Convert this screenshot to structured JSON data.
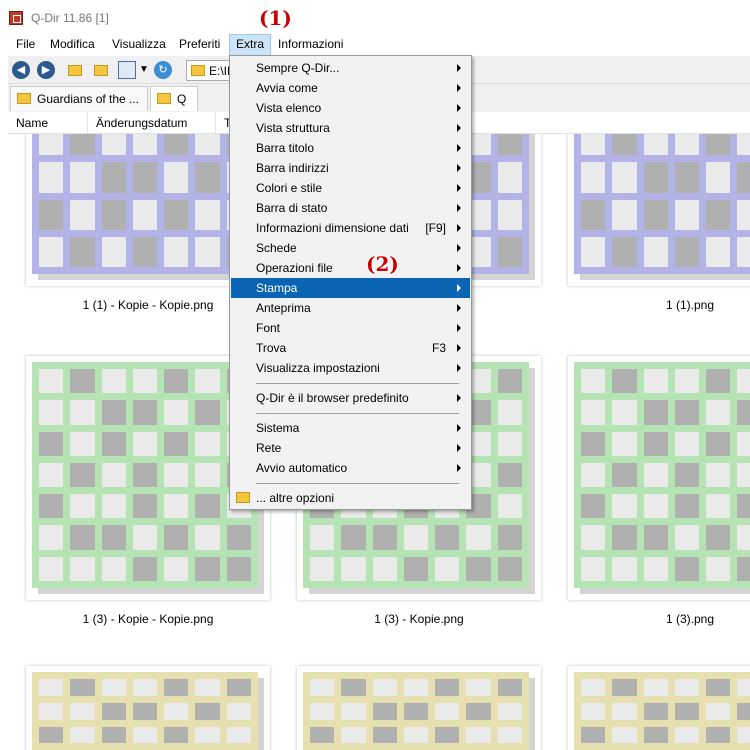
{
  "window": {
    "title": "Q-Dir 11.86 [1]"
  },
  "annotations": {
    "first": "(1)",
    "second": "(2)"
  },
  "menubar": [
    "File",
    "Modifica",
    "Visualizza",
    "Preferiti",
    "Extra",
    "Informazioni"
  ],
  "address": {
    "path": "E:\\INE"
  },
  "tabs": [
    {
      "label": "Guardians of the ..."
    },
    {
      "label": "Q"
    }
  ],
  "columns": [
    "Name",
    "Änderungsdatum",
    "T"
  ],
  "files": [
    {
      "name": "1 (1) - Kopie - Kopie.png",
      "color": "#b3b3e8"
    },
    {
      "name": "",
      "color": "#b3b3e8"
    },
    {
      "name": "1 (1).png",
      "color": "#b3b3e8"
    },
    {
      "name": "1 (3) - Kopie - Kopie.png",
      "color": "#b6e3b3"
    },
    {
      "name": "1 (3) - Kopie.png",
      "color": "#b6e3b3"
    },
    {
      "name": "1 (3).png",
      "color": "#b6e3b3"
    },
    {
      "name": "",
      "color": "#e6e0b0"
    },
    {
      "name": "",
      "color": "#e6e0b0"
    },
    {
      "name": "",
      "color": "#e6e0b0"
    }
  ],
  "menu": {
    "items": [
      {
        "label": "Sempre Q-Dir...",
        "submenu": true
      },
      {
        "label": "Avvia come",
        "submenu": true
      },
      {
        "label": "Vista elenco",
        "submenu": true
      },
      {
        "label": "Vista struttura",
        "submenu": true
      },
      {
        "label": "Barra titolo",
        "submenu": true
      },
      {
        "label": "Barra indirizzi",
        "submenu": true
      },
      {
        "label": "Colori e stile",
        "submenu": true
      },
      {
        "label": "Barra di stato",
        "submenu": true
      },
      {
        "label": "Informazioni dimensione dati",
        "shortcut": "[F9]",
        "submenu": true
      },
      {
        "label": "Schede",
        "submenu": true
      },
      {
        "label": "Operazioni file",
        "submenu": true
      },
      {
        "label": "Stampa",
        "submenu": true,
        "highlighted": true
      },
      {
        "label": "Anteprima",
        "submenu": true
      },
      {
        "label": "Font",
        "submenu": true
      },
      {
        "label": "Trova",
        "shortcut": "F3",
        "submenu": true
      },
      {
        "label": "Visualizza impostazioni",
        "submenu": true
      },
      {
        "separator": true
      },
      {
        "label": "Q-Dir è il browser predefinito",
        "submenu": true
      },
      {
        "separator": true
      },
      {
        "label": "Sistema",
        "submenu": true
      },
      {
        "label": "Rete",
        "submenu": true
      },
      {
        "label": "Avvio automatico",
        "submenu": true
      },
      {
        "separator": true
      },
      {
        "label": "... altre opzioni",
        "icon": "folder-icon"
      }
    ]
  }
}
